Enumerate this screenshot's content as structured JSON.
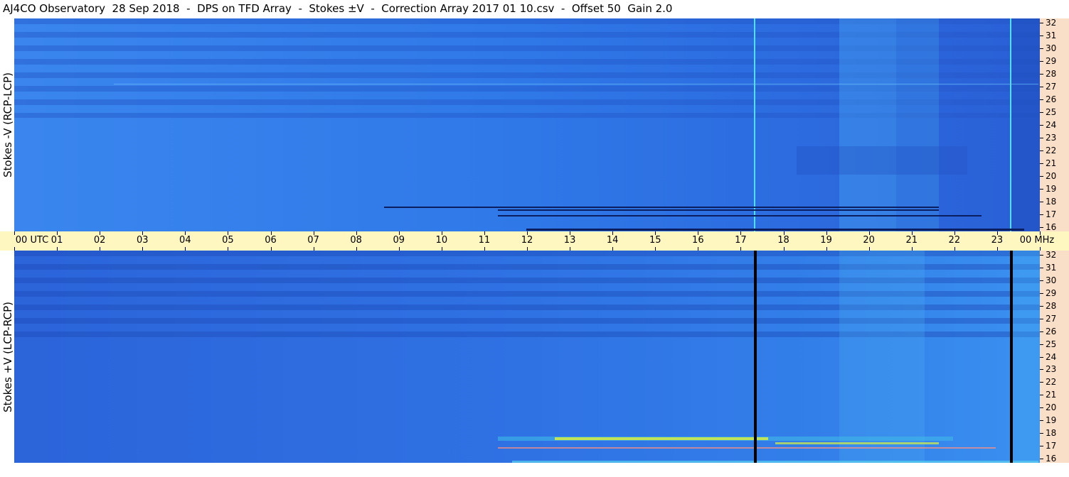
{
  "title": "AJ4CO Observatory  28 Sep 2018  -  DPS on TFD Array  -  Stokes ±V  -  Correction Array 2017 01 10.csv  -  Offset 50  Gain 2.0",
  "top_panel": {
    "ylabel": "Stokes -V (RCP-LCP)"
  },
  "bottom_panel": {
    "ylabel": "Stokes +V (LCP-RCP)"
  },
  "time_axis": {
    "labels": [
      "00  UTC",
      "01",
      "02",
      "03",
      "04",
      "05",
      "06",
      "07",
      "08",
      "09",
      "10",
      "11",
      "12",
      "13",
      "14",
      "15",
      "16",
      "17",
      "18",
      "19",
      "20",
      "21",
      "22",
      "23",
      "00 MHz"
    ]
  },
  "freq_axis": {
    "labels": [
      "32",
      "31",
      "30",
      "29",
      "28",
      "27",
      "26",
      "25",
      "24",
      "23",
      "22",
      "21",
      "20",
      "19",
      "18",
      "17",
      "16"
    ]
  },
  "colors": {
    "background": "#2f6fe0",
    "axis_band": "#fff6c0",
    "freq_band": "#fadfc8",
    "burst_yellow": "#d8f040",
    "gap_black": "#000000"
  }
}
